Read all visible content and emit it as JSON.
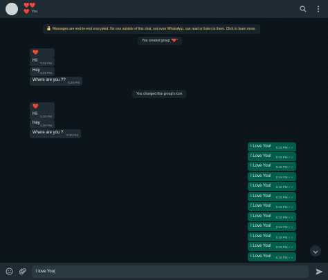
{
  "header": {
    "group_name": "❤️❤️",
    "subtitle_heart": "❤️",
    "subtitle_member": "You",
    "search_icon": "search-icon",
    "menu_icon": "kebab-menu-icon"
  },
  "system": {
    "encryption": "Messages are end-to-end encrypted. No one outside of this chat, not even WhatsApp, can read or listen to them. Click to learn more.",
    "created": "You created group \"❤️\"",
    "icon_changed": "You changed this group's icon"
  },
  "incoming_1": [
    {
      "text": "❤️",
      "time": ""
    },
    {
      "text": "Hii",
      "time": "5:29 PM"
    },
    {
      "text": "Hey",
      "time": "5:29 PM"
    },
    {
      "text": "Where are you ??",
      "time": "5:29 PM"
    }
  ],
  "incoming_2": [
    {
      "text": "❤️",
      "time": ""
    },
    {
      "text": "Hii",
      "time": "5:30 PM"
    },
    {
      "text": "Hey",
      "time": "5:30 PM"
    },
    {
      "text": "Where are you ?",
      "time": "5:30 PM"
    }
  ],
  "outgoing": [
    {
      "text": "I Love You!",
      "time": "5:19 PM"
    },
    {
      "text": "I Love You!",
      "time": "5:19 PM"
    },
    {
      "text": "I Love You!",
      "time": "5:19 PM"
    },
    {
      "text": "I Love You!",
      "time": "5:19 PM"
    },
    {
      "text": "I Love You!",
      "time": "5:19 PM"
    },
    {
      "text": "I Love You!",
      "time": "5:19 PM"
    },
    {
      "text": "I Love You!",
      "time": "5:19 PM"
    },
    {
      "text": "I Love You!",
      "time": "5:19 PM"
    },
    {
      "text": "I Love You!",
      "time": "5:19 PM"
    },
    {
      "text": "I Love You!",
      "time": "5:19 PM"
    },
    {
      "text": "I Love You!",
      "time": "5:19 PM"
    },
    {
      "text": "I Love You!",
      "time": "5:19 PM"
    }
  ],
  "composer": {
    "value": "I love You(",
    "emoji_icon": "emoji-icon",
    "attach_icon": "paperclip-icon",
    "send_icon": "send-icon"
  },
  "colors": {
    "outgoing_bubble": "#005c4b",
    "incoming_bubble": "#202c33",
    "background": "#0b141a"
  }
}
